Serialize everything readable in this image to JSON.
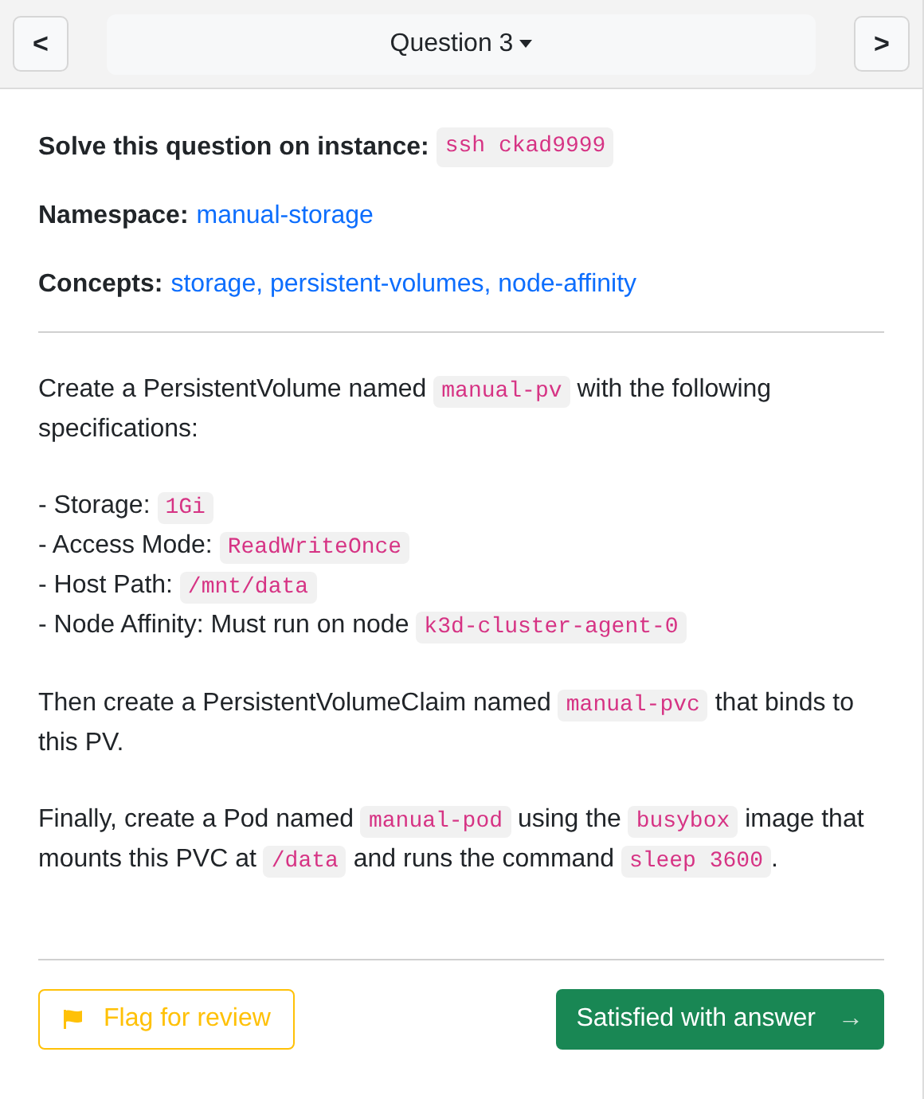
{
  "nav": {
    "prev": "<",
    "title": "Question 3",
    "next": ">"
  },
  "meta": [
    {
      "label": "Solve this question on instance:",
      "value": "ssh ckad9999",
      "kind": "code"
    },
    {
      "label": "Namespace:",
      "value": "manual-storage",
      "kind": "link"
    },
    {
      "label": "Concepts:",
      "value": "storage, persistent-volumes, node-affinity",
      "kind": "link"
    }
  ],
  "description": [
    {
      "lines": [
        [
          {
            "kind": "text",
            "text": "Create a PersistentVolume named "
          },
          {
            "kind": "code",
            "text": "manual-pv"
          },
          {
            "kind": "text",
            "text": " with the following specifications:"
          }
        ]
      ]
    },
    {
      "lines": [
        [
          {
            "kind": "text",
            "text": "- Storage: "
          },
          {
            "kind": "code",
            "text": "1Gi"
          }
        ],
        [
          {
            "kind": "text",
            "text": "- Access Mode: "
          },
          {
            "kind": "code",
            "text": "ReadWriteOnce"
          }
        ],
        [
          {
            "kind": "text",
            "text": "- Host Path: "
          },
          {
            "kind": "code",
            "text": "/mnt/data"
          }
        ],
        [
          {
            "kind": "text",
            "text": "- Node Affinity: Must run on node "
          },
          {
            "kind": "code",
            "text": "k3d-cluster-agent-0"
          }
        ]
      ]
    },
    {
      "lines": [
        [
          {
            "kind": "text",
            "text": "Then create a PersistentVolumeClaim named "
          },
          {
            "kind": "code",
            "text": "manual-pvc"
          },
          {
            "kind": "text",
            "text": " that binds to this PV."
          }
        ]
      ]
    },
    {
      "lines": [
        [
          {
            "kind": "text",
            "text": "Finally, create a Pod named "
          },
          {
            "kind": "code",
            "text": "manual-pod"
          },
          {
            "kind": "text",
            "text": " using the "
          },
          {
            "kind": "code",
            "text": "busybox"
          },
          {
            "kind": "text",
            "text": " image that mounts this PVC at "
          },
          {
            "kind": "code",
            "text": "/data"
          },
          {
            "kind": "text",
            "text": " and runs the command "
          },
          {
            "kind": "code",
            "text": "sleep 3600"
          },
          {
            "kind": "text",
            "text": "."
          }
        ]
      ]
    }
  ],
  "actions": {
    "flag": "Flag for review",
    "satisfied": "Satisfied with answer",
    "satisfied_arrow": "→"
  }
}
